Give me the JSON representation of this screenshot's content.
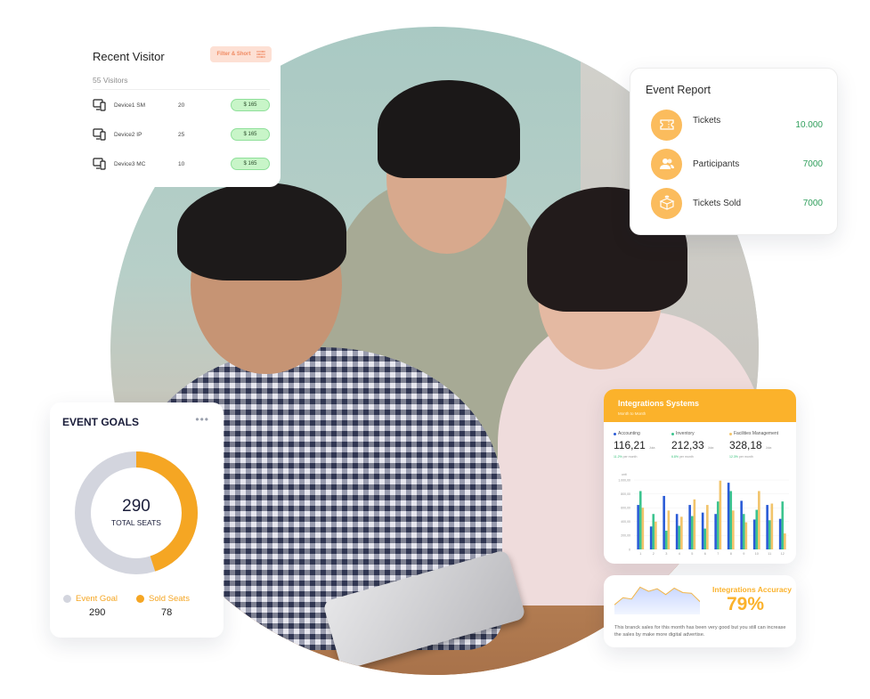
{
  "recent_visitor": {
    "title": "Recent Visitor",
    "filter_button": "Filter & Short",
    "count_label": "55 Visitors",
    "rows": [
      {
        "icon": "devices-icon",
        "name": "Device1 SM",
        "count": "20",
        "amount": "$ 165"
      },
      {
        "icon": "devices-icon",
        "name": "Device2 IP",
        "count": "25",
        "amount": "$ 165"
      },
      {
        "icon": "devices-icon",
        "name": "Device3 MC",
        "count": "10",
        "amount": "$ 165"
      }
    ]
  },
  "event_report": {
    "title": "Event Report",
    "items": [
      {
        "icon": "ticket-icon",
        "label": "Tickets",
        "value": "10.000"
      },
      {
        "icon": "users-icon",
        "label": "Participants",
        "value": "7000"
      },
      {
        "icon": "box-icon",
        "label": "Tickets Sold",
        "value": "7000"
      }
    ]
  },
  "event_goals": {
    "title": "EVENT GOALS",
    "more_icon": "more-horizontal-icon",
    "total_value": "290",
    "total_label": "TOTAL SEATS",
    "sold_fraction": 0.45,
    "legend": [
      {
        "label": "Event Goal",
        "value": "290",
        "color": "#d3d5de"
      },
      {
        "label": "Sold Seats",
        "value": "78",
        "color": "#f5a623"
      }
    ]
  },
  "integrations_systems": {
    "title": "Integrations Systems",
    "subtitle": "Month to Month",
    "metrics": [
      {
        "label": "Accounting",
        "value": "116,21",
        "unit": "Juta",
        "change": "11.2%",
        "change_suffix": "per month",
        "color": "#2a5bd7"
      },
      {
        "label": "Inventory",
        "value": "212,33",
        "unit": "Juta",
        "change": "6.8%",
        "change_suffix": "per month",
        "color": "#3cc48f"
      },
      {
        "label": "Facilities Management",
        "value": "328,18",
        "unit": "Juta",
        "change": "12.3%",
        "change_suffix": "per month",
        "color": "#f2c46a"
      }
    ]
  },
  "chart_data": {
    "type": "bar",
    "title": "Integrations Systems",
    "ylabel": "unit",
    "xlabel": "",
    "ylim": [
      0,
      1000
    ],
    "yticks": [
      "0",
      "200,00",
      "400,00",
      "600,00",
      "800,00",
      "1.000,00"
    ],
    "ytick_values": [
      0,
      200,
      400,
      600,
      800,
      1000
    ],
    "grid": true,
    "categories": [
      "1",
      "2",
      "3",
      "4",
      "5",
      "6",
      "7",
      "8",
      "9",
      "10",
      "11",
      "12"
    ],
    "series": [
      {
        "name": "Accounting",
        "color": "#2a5bd7",
        "values": [
          640,
          330,
          770,
          510,
          640,
          530,
          510,
          960,
          700,
          430,
          640,
          440
        ]
      },
      {
        "name": "Inventory",
        "color": "#3cc48f",
        "values": [
          840,
          510,
          270,
          340,
          480,
          300,
          690,
          840,
          510,
          570,
          420,
          690
        ]
      },
      {
        "name": "Facilities Management",
        "color": "#f2c46a",
        "values": [
          600,
          400,
          560,
          470,
          720,
          640,
          990,
          560,
          390,
          840,
          660,
          230
        ]
      }
    ]
  },
  "integrations_accuracy": {
    "title": "Integrations Accuracy",
    "percent": "79%",
    "description": "This branck sales for this month has been very good but you still can increase the sales by make more digital advertise.",
    "sparkline": [
      30,
      52,
      48,
      85,
      72,
      80,
      62,
      82,
      68,
      66,
      40
    ],
    "line_color": "#f2b64a",
    "fill_color": "#c9d7ff"
  }
}
